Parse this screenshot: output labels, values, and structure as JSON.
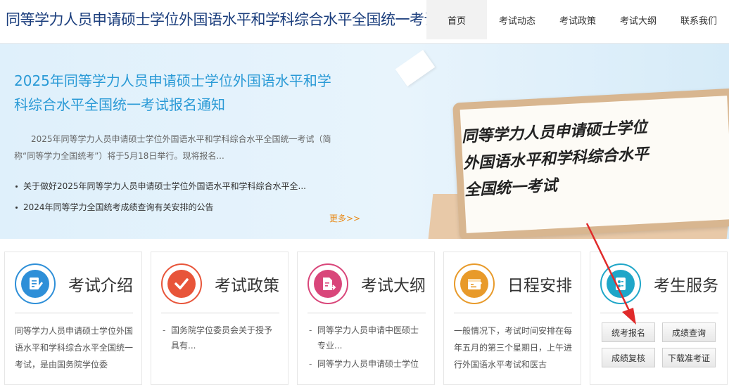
{
  "header": {
    "site_title": "同等学力人员申请硕士学位外国语水平和学科综合水平全国统一考试",
    "nav": [
      "首页",
      "考试动态",
      "考试政策",
      "考试大纲",
      "联系我们"
    ]
  },
  "banner": {
    "title": "2025年同等学力人员申请硕士学位外国语水平和学科综合水平全国统一考试报名通知",
    "desc": "2025年同等学力人员申请硕士学位外国语水平和学科综合水平全国统一考试（简称“同等学力全国统考”）将于5月18日举行。现将报名...",
    "news": [
      "关于做好2025年同等学力人员申请硕士学位外国语水平和学科综合水平全...",
      "2024年同等学力全国统考成绩查询有关安排的公告"
    ],
    "more_label": "更多>>",
    "board_lines": [
      "同等学力人员申请硕士学位",
      "外国语水平和学科综合水平",
      "全国统一考试"
    ]
  },
  "cards": {
    "intro": {
      "title": "考试介绍",
      "icon": "document-edit-icon",
      "color": "#2e8fd8",
      "text": "同等学力人员申请硕士学位外国语水平和学科综合水平全国统一考试，是由国务院学位委"
    },
    "policy": {
      "title": "考试政策",
      "icon": "checkmark-icon",
      "color": "#e8553a",
      "items": [
        "国务院学位委员会关于授予具有..."
      ]
    },
    "syllabus": {
      "title": "考试大纲",
      "icon": "document-export-icon",
      "color": "#d9467a",
      "items": [
        "同等学力人员申请中医硕士专业...",
        "同等学力人员申请硕士学位"
      ]
    },
    "schedule": {
      "title": "日程安排",
      "icon": "calendar-icon",
      "color": "#e89a2a",
      "text": "一般情况下，考试时间安排在每年五月的第三个星期日，上午进行外国语水平考试和医古"
    },
    "service": {
      "title": "考生服务",
      "icon": "id-card-icon",
      "color": "#1fa6c8",
      "buttons": [
        "统考报名",
        "成绩查询",
        "成绩复核",
        "下载准考证"
      ]
    }
  }
}
